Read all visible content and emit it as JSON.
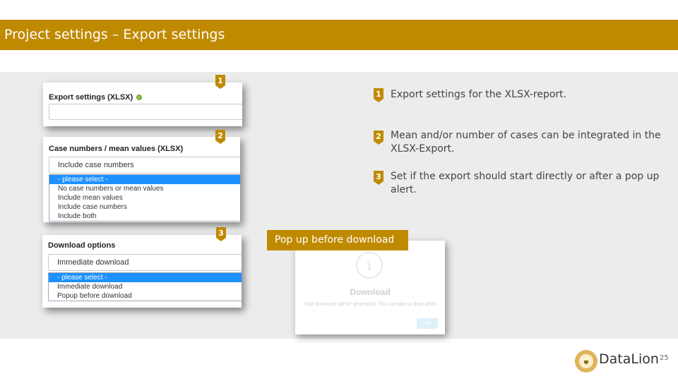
{
  "slide": {
    "title": "Project settings – Export settings",
    "page_number": "25",
    "brand_color": "#c08a00",
    "logo_text": "DataLion",
    "logo_icon": "lion-face-icon"
  },
  "panel1": {
    "label": "Export settings (XLSX)",
    "help_icon": "help-circle-icon",
    "input_value": ""
  },
  "panel2": {
    "label": "Case numbers / mean values (XLSX)",
    "selected_value": "Include case numbers",
    "options": [
      "- please select -",
      "No case numbers or mean values",
      "Include mean values",
      "Include case numbers",
      "Include both"
    ],
    "highlighted_option": "- please select -"
  },
  "panel3": {
    "label": "Download options",
    "selected_value": "Immediate download",
    "options": [
      "- please select -",
      "Immediate download",
      "Popup before download"
    ],
    "highlighted_option": "- please select -"
  },
  "markers": [
    "1",
    "2",
    "3"
  ],
  "descriptions": [
    {
      "num": "1",
      "text": "Export settings for the XLSX-report."
    },
    {
      "num": "2",
      "text": "Mean and/or number of cases can be integrated in the XLSX-Export."
    },
    {
      "num": "3",
      "text": "Set if the export should start directly or after a pop up alert."
    }
  ],
  "popup": {
    "tag": "Pop up before download",
    "icon": "info-icon",
    "icon_glyph": "i",
    "title": "Download",
    "message": "Your download will be generated. This can take a short while",
    "ok_label": "OK"
  }
}
